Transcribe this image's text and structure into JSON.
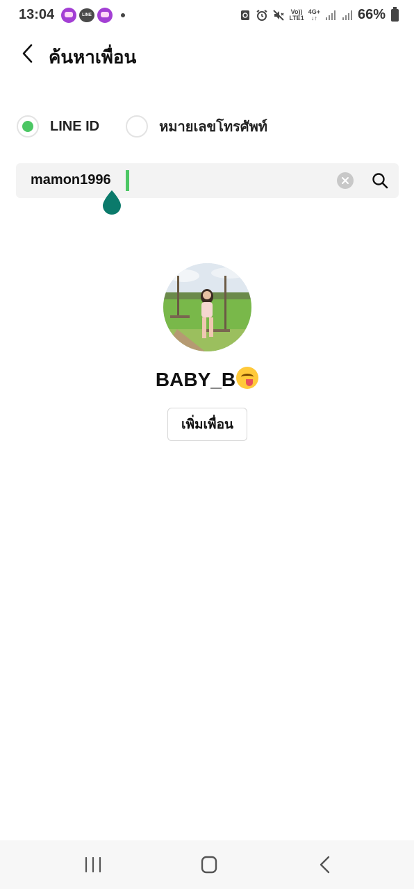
{
  "status_bar": {
    "time": "13:04",
    "line_badge": "LINE",
    "volte": "Vo))",
    "lte": "LTE1",
    "network": "4G+",
    "battery": "66%"
  },
  "header": {
    "title": "ค้นหาเพื่อน"
  },
  "search_type": {
    "options": [
      {
        "label": "LINE ID",
        "selected": true
      },
      {
        "label": "หมายเลขโทรศัพท์",
        "selected": false
      }
    ]
  },
  "search": {
    "value": "mamon1996"
  },
  "result": {
    "name": "BABY_B",
    "add_button": "เพิ่มเพื่อน"
  },
  "colors": {
    "accent": "#4cc764",
    "handle": "#0b7a6b"
  }
}
